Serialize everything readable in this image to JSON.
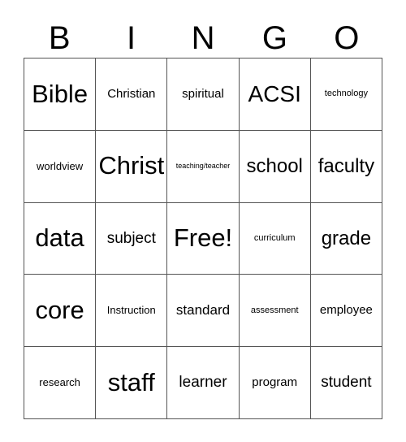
{
  "card": {
    "title": "BINGO card",
    "header_letters": [
      "B",
      "I",
      "N",
      "G",
      "O"
    ],
    "free_space_label": "Free!",
    "grid": {
      "rows": 5,
      "columns": 5,
      "border_color": "#555555",
      "background_color": "#ffffff",
      "text_color": "#000000"
    },
    "cells": [
      [
        {
          "text": "Bible",
          "size": "xxl"
        },
        {
          "text": "Christian",
          "size": "xs"
        },
        {
          "text": "spiritual",
          "size": "xs"
        },
        {
          "text": "ACSI",
          "size": "xl"
        },
        {
          "text": "technology",
          "size": "tiny"
        }
      ],
      [
        {
          "text": "worldview",
          "size": "xxs"
        },
        {
          "text": "Christ",
          "size": "xxl"
        },
        {
          "text": "teaching/teacher",
          "size": "micro"
        },
        {
          "text": "school",
          "size": "lg"
        },
        {
          "text": "faculty",
          "size": "lg"
        }
      ],
      [
        {
          "text": "data",
          "size": "xxl"
        },
        {
          "text": "subject",
          "size": "md"
        },
        {
          "text": "Free!",
          "size": "xxl"
        },
        {
          "text": "curriculum",
          "size": "tiny"
        },
        {
          "text": "grade",
          "size": "lg"
        }
      ],
      [
        {
          "text": "core",
          "size": "xxl"
        },
        {
          "text": "Instruction",
          "size": "xxs"
        },
        {
          "text": "standard",
          "size": "sm"
        },
        {
          "text": "assessment",
          "size": "tiny"
        },
        {
          "text": "employee",
          "size": "xs"
        }
      ],
      [
        {
          "text": "research",
          "size": "xxs"
        },
        {
          "text": "staff",
          "size": "xxl"
        },
        {
          "text": "learner",
          "size": "md"
        },
        {
          "text": "program",
          "size": "xs"
        },
        {
          "text": "student",
          "size": "md"
        }
      ]
    ]
  }
}
